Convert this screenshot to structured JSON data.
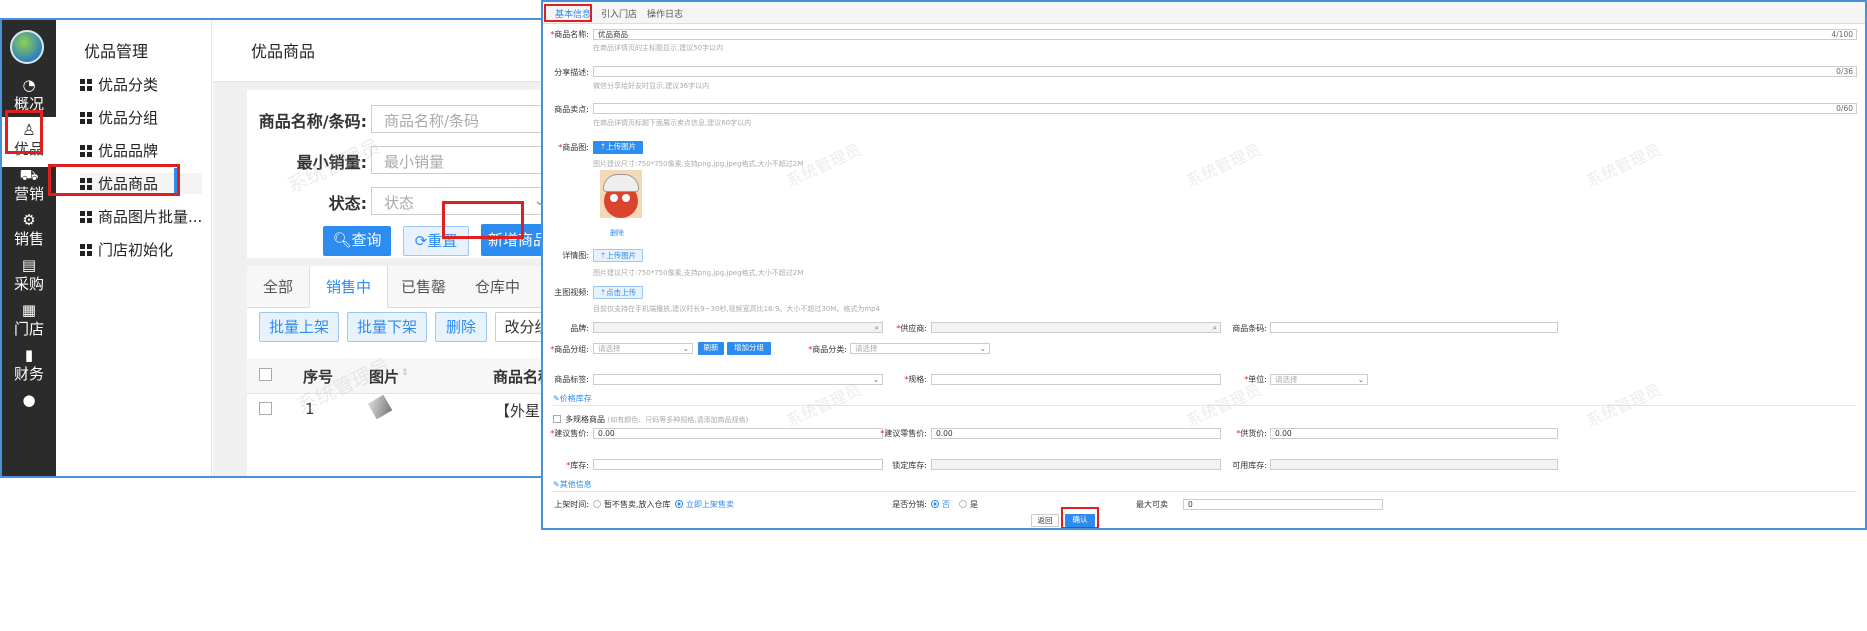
{
  "left": {
    "rail": [
      {
        "icon": "dashboard-icon",
        "label": "概况"
      },
      {
        "icon": "product-bag-icon",
        "label": "优品"
      },
      {
        "icon": "cart-icon",
        "label": "营销"
      },
      {
        "icon": "gear-icon",
        "label": "销售"
      },
      {
        "icon": "document-icon",
        "label": "采购"
      },
      {
        "icon": "store-icon",
        "label": "门店"
      },
      {
        "icon": "chart-bars-icon",
        "label": "财务"
      },
      {
        "icon": "user-icon",
        "label": ""
      }
    ],
    "menu": {
      "header": "优品管理",
      "items": [
        "优品分类",
        "优品分组",
        "优品品牌",
        "优品商品",
        "商品图片批量...",
        "门店初始化"
      ]
    },
    "page_title": "优品商品",
    "form": {
      "name_label": "商品名称/条码:",
      "name_placeholder": "商品名称/条码",
      "minsales_label": "最小销量:",
      "minsales_placeholder": "最小销量",
      "status_label": "状态:",
      "status_placeholder": "状态",
      "query_btn": "查询",
      "reset_btn": "重置",
      "add_btn": "新增商品"
    },
    "tabs": [
      "全部",
      "销售中",
      "已售罄",
      "仓库中"
    ],
    "actions": [
      "批量上架",
      "批量下架",
      "删除",
      "改分组"
    ],
    "columns": [
      "序号",
      "图片",
      "商品名称"
    ],
    "rows": [
      {
        "index": "1",
        "name": "【外星人】"
      }
    ],
    "watermark": "系统管理员"
  },
  "right": {
    "tabs": [
      "基本信息",
      "引入门店",
      "操作日志"
    ],
    "product_name_label": "商品名称:",
    "product_name_value": "优品商品",
    "product_name_count": "4/100",
    "product_name_hint": "在商品详情页的主标题显示,建议50字以内",
    "share_label": "分享描述:",
    "share_count": "0/36",
    "share_hint": "微信分享给好友时显示,建议36字以内",
    "selling_label": "商品卖点:",
    "selling_count": "0/60",
    "selling_hint": "在商品详情页标题下面展示卖点信息,建议60字以内",
    "image_label": "商品图:",
    "upload_btn": "上传图片",
    "image_hint": "图片建议尺寸:750*750像素,支持png,jpg,jpeg格式,大小不超过2M",
    "delete_link": "删除",
    "detail_label": "详情图:",
    "detail_upload_btn": "上传图片",
    "detail_hint": "图片建议尺寸:750*750像素,支持png,jpg,jpeg格式,大小不超过2M",
    "video_label": "主图视频:",
    "video_upload_btn": "点击上传",
    "video_hint": "目前仅支持在手机端播放,建议时长9~30秒,视频宽高比16:9。大小不超过30M。格式为mp4",
    "brand_label": "品牌:",
    "supplier_label": "供应商:",
    "barcode_label": "商品条码:",
    "group_label": "商品分组:",
    "select_placeholder": "请选择",
    "refresh_btn": "刷新",
    "add_group_btn": "增加分组",
    "category_label": "商品分类:",
    "tag_label": "商品标签:",
    "spec_label": "规格:",
    "unit_label": "单位:",
    "price_section": "价格库存",
    "multi_spec": "多规格商品",
    "multi_spec_hint": "(如有颜色、尺码等多种规格,请添加商品规格)",
    "suggest_price_label": "建议售价:",
    "suggest_price_value": "0.00",
    "suggest_retail_label": "建议零售价:",
    "suggest_retail_value": "0.00",
    "supply_price_label": "供货价:",
    "supply_price_value": "0.00",
    "stock_label": "库存:",
    "locked_stock_label": "锁定库存:",
    "available_stock_label": "可用库存:",
    "other_section": "其他信息",
    "listing_label": "上架时间:",
    "listing_opt1": "暂不售卖,放入仓库",
    "listing_opt2": "立即上架售卖",
    "distribution_label": "是否分销:",
    "dist_no": "否",
    "dist_yes": "是",
    "max_label": "最大可卖",
    "max_value": "0",
    "back_btn": "返回",
    "confirm_btn": "确认",
    "watermark": "系统管理员"
  },
  "colors": {
    "accent": "#2d8cf0",
    "highlight": "#e02020",
    "rail": "#2b2b2b"
  }
}
